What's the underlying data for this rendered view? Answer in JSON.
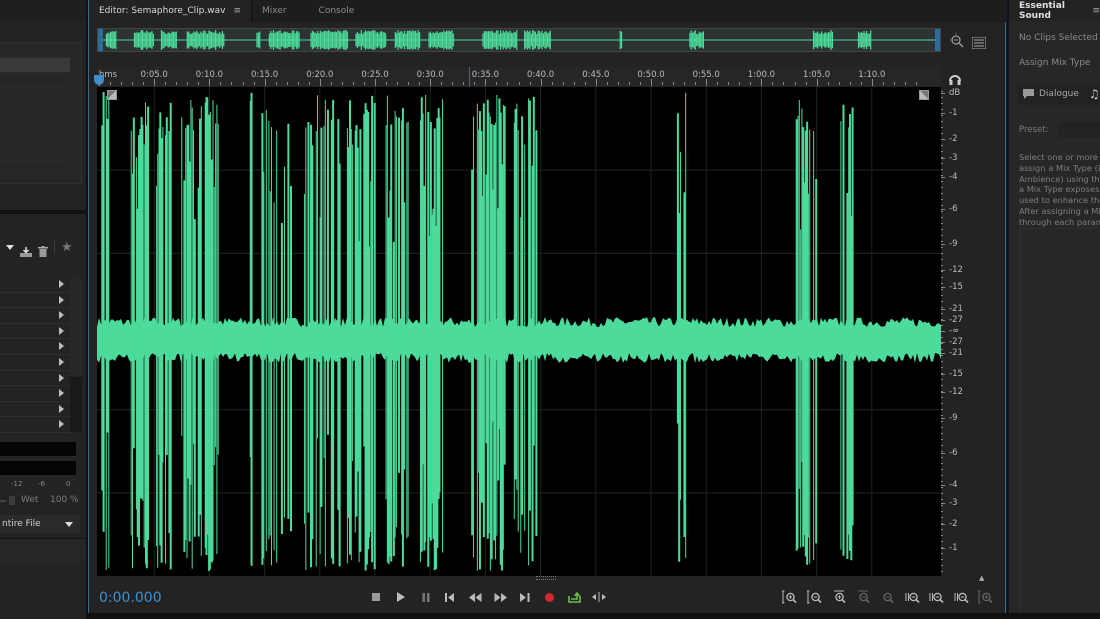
{
  "left_panel": {
    "effects_rack": {
      "preset_dropdown_caret": "chevron-down",
      "actions": [
        "save-preset",
        "delete-preset",
        "favorite"
      ],
      "effect_slots": 10,
      "meter_scale": [
        "-12",
        "-6",
        "0"
      ],
      "wet_label": "Wet",
      "wet_value": "100 %",
      "process_range": "ntire File"
    }
  },
  "editor": {
    "tabs": [
      {
        "label": "Editor: Semaphore_Clip.wav",
        "active": true,
        "menu_icon": "≡"
      },
      {
        "label": "Mixer",
        "active": false
      },
      {
        "label": "Console",
        "active": false
      }
    ],
    "ruler": {
      "unit_label": "hms",
      "ticks": [
        "0:05.0",
        "0:10.0",
        "0:15.0",
        "0:20.0",
        "0:25.0",
        "0:30.0",
        "0:35.0",
        "0:40.0",
        "0:45.0",
        "0:50.0",
        "0:55.0",
        "1:00.0",
        "1:05.0",
        "1:10.0"
      ],
      "total_seconds": 74
    },
    "db_scale": {
      "unit": "dB",
      "top_labels": [
        "-1",
        "-2",
        "-3",
        "-4",
        "-6",
        "-9",
        "-12",
        "-15",
        "-21",
        "-27"
      ],
      "center_label": "-∞",
      "bottom_labels": [
        "-27",
        "-21",
        "-15",
        "-12",
        "-9",
        "-6",
        "-4",
        "-3",
        "-2",
        "-1"
      ]
    },
    "waveform": {
      "color": "#4cdb9a",
      "bursts_seconds": [
        [
          0.3,
          1.2
        ],
        [
          2.8,
          4.6
        ],
        [
          5.2,
          6.6
        ],
        [
          7.5,
          10.8
        ],
        [
          13.7,
          14.0
        ],
        [
          14.8,
          17.5
        ],
        [
          18.5,
          21.8
        ],
        [
          22.5,
          25.2
        ],
        [
          26.0,
          28.2
        ],
        [
          29.0,
          31.2
        ],
        [
          33.8,
          36.8
        ],
        [
          37.5,
          39.8
        ],
        [
          46.0,
          46.2
        ],
        [
          52.2,
          53.4
        ],
        [
          63.2,
          65.0
        ],
        [
          67.2,
          68.4
        ]
      ]
    },
    "transport": {
      "time": "0:00.000",
      "buttons": [
        "stop",
        "play",
        "pause",
        "skip-to-start",
        "rewind",
        "fast-forward",
        "skip-to-end",
        "record",
        "loop-playback",
        "skip-selection"
      ],
      "record_color": "#d02a2a",
      "loop_color": "#6cc04a"
    },
    "zoom_buttons": [
      "zoom-in-amplitude",
      "zoom-out-amplitude",
      "zoom-in-time",
      "zoom-out-time",
      "zoom-out-full",
      "zoom-in-selection-start",
      "zoom-in-selection-end",
      "zoom-to-selection",
      "zoom-in-amplitude-full"
    ]
  },
  "right_panel": {
    "title": "Essential Sound",
    "menu_icon": "≡",
    "no_clips": "No Clips Selected",
    "assign_label": "Assign Mix Type",
    "mix_types": [
      {
        "label": "Dialogue",
        "icon": "speech-bubble"
      },
      {
        "label": "",
        "icon": "music-note"
      }
    ],
    "preset_label": "Preset:",
    "description_lines": [
      "Select one or more c",
      "assign a Mix Type (D",
      "Ambience) using the",
      "a Mix Type exposes a",
      "used to enhance that",
      "After assigning a Mix",
      "through each param"
    ]
  }
}
